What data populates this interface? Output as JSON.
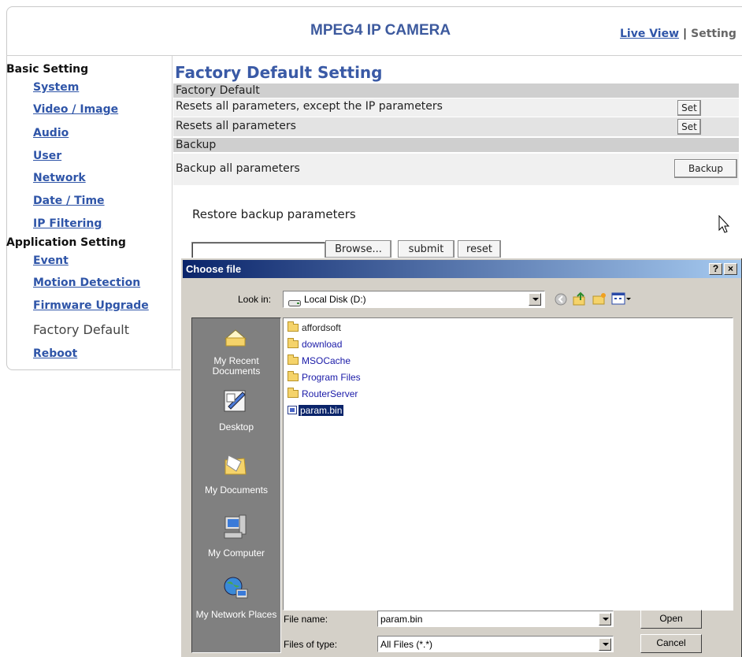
{
  "header": {
    "title": "MPEG4 IP CAMERA",
    "nav": {
      "live_view": "Live View",
      "separator": "|",
      "setting": "Setting"
    }
  },
  "sidebar": {
    "basic_heading": "Basic Setting",
    "basic_items": [
      "System",
      "Video / Image",
      "Audio",
      "User",
      "Network",
      "Date / Time",
      "IP Filtering"
    ],
    "application_heading": "Application Setting",
    "application_items": [
      "Event",
      "Motion Detection",
      "Firmware Upgrade",
      "Factory Default",
      "Reboot"
    ],
    "current_item": "Factory Default"
  },
  "main": {
    "title": "Factory Default Setting",
    "factory_section": "Factory Default",
    "reset_except_ip": {
      "label": "Resets all parameters, except the IP parameters",
      "button": "Set"
    },
    "reset_all": {
      "label": "Resets all parameters",
      "button": "Set"
    },
    "backup_section": "Backup",
    "backup_all": {
      "label": "Backup all parameters",
      "button": "Backup"
    },
    "restore": {
      "label": "Restore backup parameters",
      "file_value": "",
      "browse_button": "Browse...",
      "submit_button": "submit",
      "reset_button": "reset"
    }
  },
  "dialog": {
    "title": "Choose file",
    "help_button": "?",
    "close_button": "×",
    "look_in_label": "Look in:",
    "look_in_value": "Local Disk (D:)",
    "places": [
      "My Recent Documents",
      "Desktop",
      "My Documents",
      "My Computer",
      "My Network Places"
    ],
    "files": [
      {
        "name": "affordsoft",
        "kind": "folder",
        "color": "#000000"
      },
      {
        "name": "download",
        "kind": "folder",
        "color": "#1a1aa8"
      },
      {
        "name": "MSOCache",
        "kind": "folder",
        "color": "#1a1aa8"
      },
      {
        "name": "Program Files",
        "kind": "folder",
        "color": "#1a1aa8"
      },
      {
        "name": "RouterServer",
        "kind": "folder",
        "color": "#1a1aa8"
      },
      {
        "name": "param.bin",
        "kind": "file",
        "selected": true
      }
    ],
    "file_name_label": "File name:",
    "file_name_value": "param.bin",
    "file_type_label": "Files of type:",
    "file_type_value": "All Files (*.*)",
    "open_button": "Open",
    "cancel_button": "Cancel"
  },
  "colors": {
    "accent": "#3a5aa6",
    "link": "#2f55a8",
    "titlebar_start": "#0a246a",
    "titlebar_end": "#a6caf0",
    "selection": "#0a246a"
  }
}
